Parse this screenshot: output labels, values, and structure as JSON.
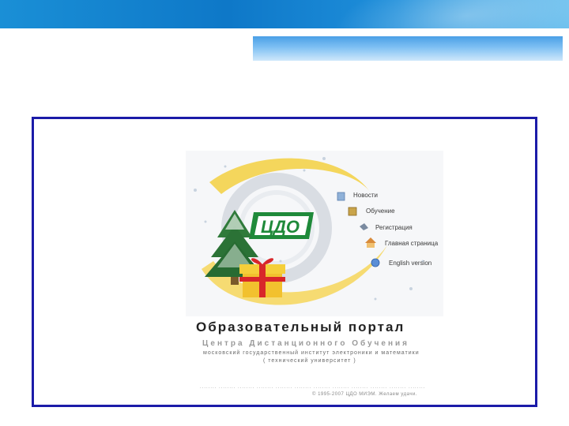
{
  "portal": {
    "nav": [
      {
        "label": "Новости",
        "icon": "news-icon"
      },
      {
        "label": "Обучение",
        "icon": "study-icon"
      },
      {
        "label": "Регистрация",
        "icon": "registration-icon"
      },
      {
        "label": "Главная страница",
        "icon": "home-icon"
      },
      {
        "label": "English version",
        "icon": "globe-icon"
      }
    ],
    "logo_text": "ЦДО",
    "heading": "Образовательный портал",
    "subheading": "Центра Дистанционного Обучения",
    "institute": "московский государственный институт электроники и математики",
    "tech_univ": "( технический университет )",
    "footer_dots": "........ ........ ........ ........ ........ ........ ........ ........ ........ ........ ........ ........",
    "copyright": "© 1995-2007 ЦДО МИЭМ. Желаем удачи."
  },
  "colors": {
    "frame_border": "#1b1ba8",
    "logo_green": "#1f8a3a",
    "banner_blue": "#0e78c8"
  }
}
